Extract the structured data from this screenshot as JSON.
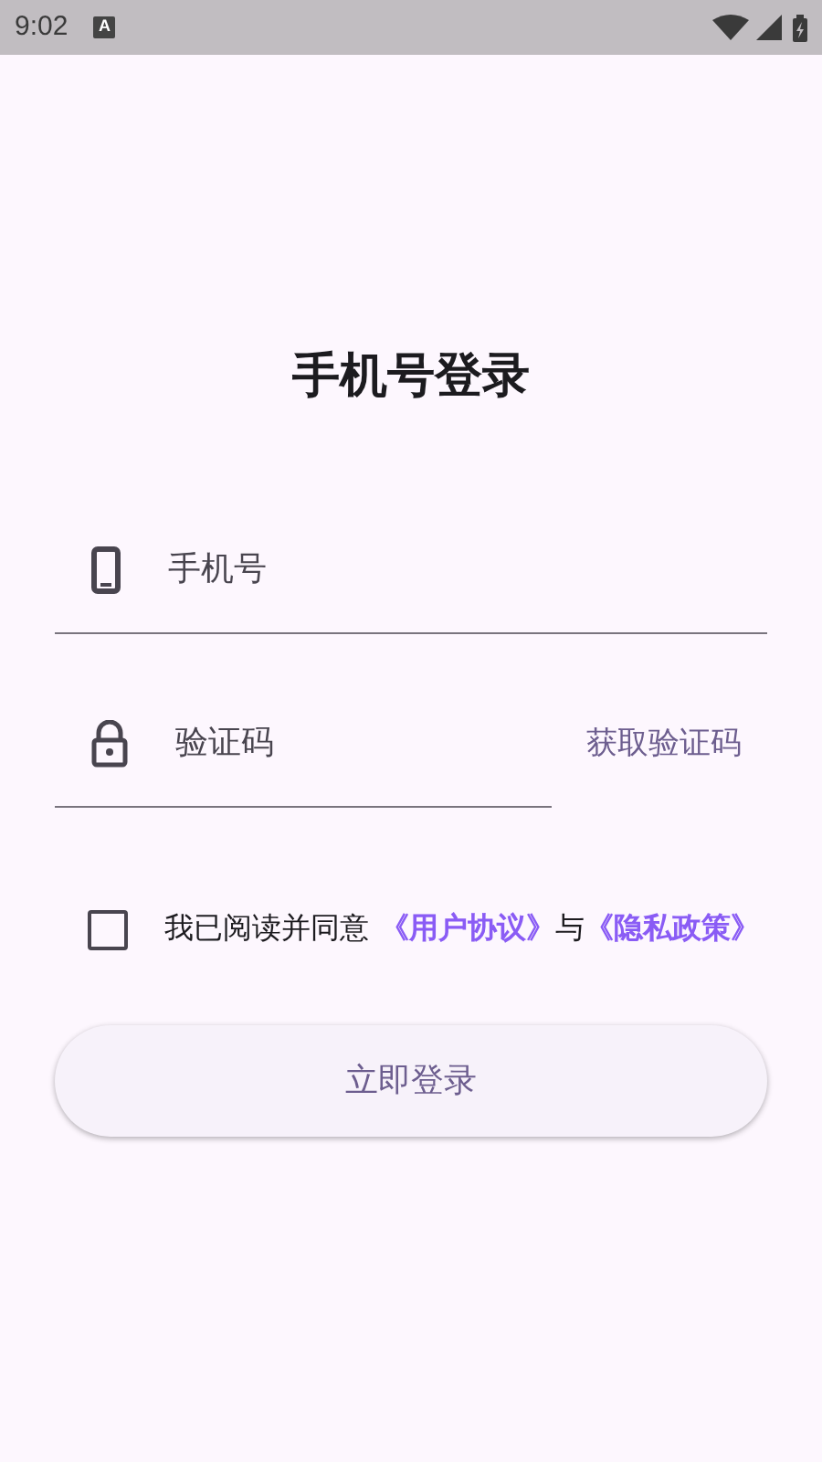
{
  "status_bar": {
    "time": "9:02",
    "notification_badge": "A"
  },
  "title": "手机号登录",
  "phone_field": {
    "placeholder": "手机号"
  },
  "code_field": {
    "placeholder": "验证码",
    "action": "获取验证码"
  },
  "agreement": {
    "checked": false,
    "text": "我已阅读并同意",
    "links": [
      "《用户协议》",
      "《隐私政策》"
    ],
    "joiner": "与"
  },
  "login_button": "立即登录"
}
